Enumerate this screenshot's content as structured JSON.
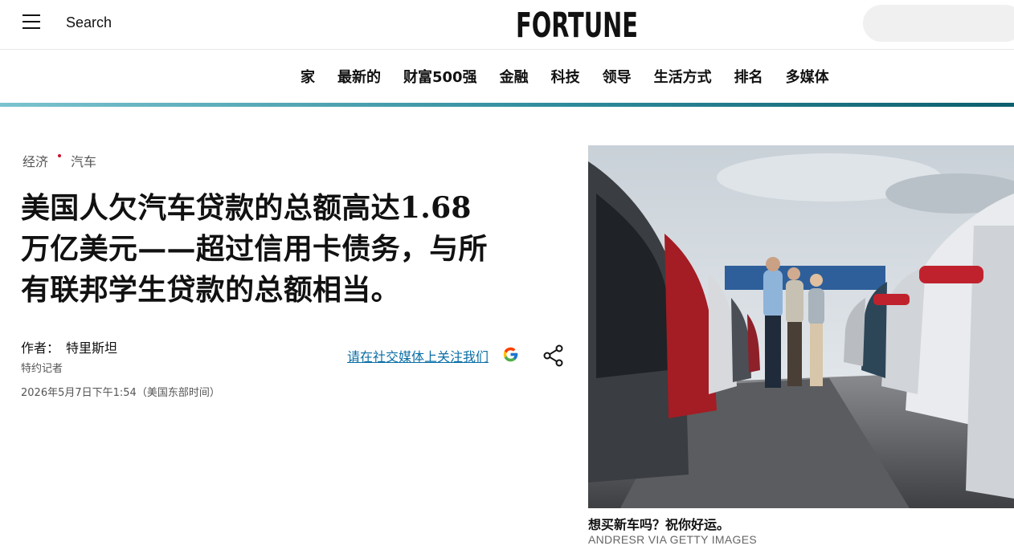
{
  "header": {
    "search_label": "Search",
    "logo_text": "FORTUNE"
  },
  "nav": {
    "items": [
      {
        "label": "家"
      },
      {
        "label": "最新的"
      },
      {
        "label": "财富500强"
      },
      {
        "label": "金融"
      },
      {
        "label": "科技"
      },
      {
        "label": "领导"
      },
      {
        "label": "生活方式"
      },
      {
        "label": "排名"
      },
      {
        "label": "多媒体"
      }
    ]
  },
  "article": {
    "breadcrumb": [
      "经济",
      "汽车"
    ],
    "headline_line1": "美国人欠汽车贷款的总额高达1.68",
    "headline_line2": "万亿美元——超过信用卡债务，与所",
    "headline_line3": "有联邦学生贷款的总额相当。",
    "author_prefix": "作者：",
    "author_name": "特里斯坦",
    "author_role": "特约记者",
    "timestamp": "2026年5月7日下午1:54（美国东部时间）",
    "follow_text": "请在社交媒体上关注我们"
  },
  "image": {
    "caption": "想买新车吗？祝你好运。",
    "credit": "ANDRESR VIA GETTY IMAGES"
  },
  "colors": {
    "accent_gradient_start": "#7cc3cf",
    "accent_gradient_end": "#0d5f6e",
    "link": "#0a6ea6",
    "breadcrumb_dot": "#c8102e"
  }
}
